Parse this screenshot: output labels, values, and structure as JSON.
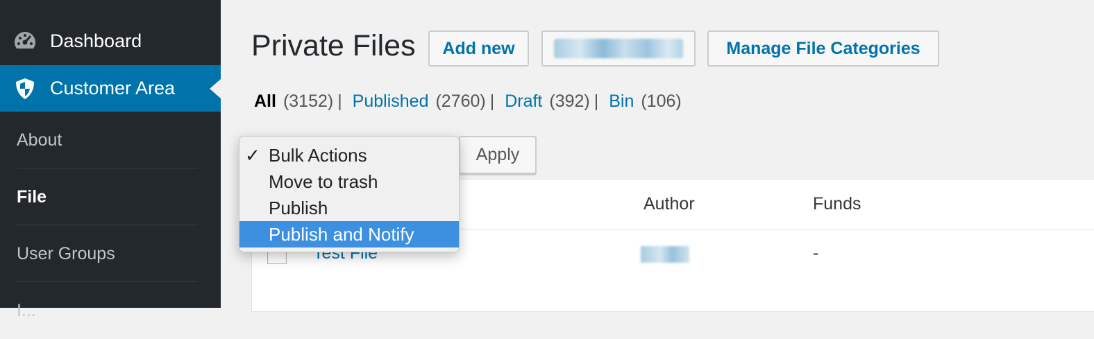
{
  "sidebar": {
    "dashboard": {
      "label": "Dashboard",
      "icon": "dashboard-gauge-icon"
    },
    "customer_area": {
      "label": "Customer Area",
      "icon": "shield-icon"
    },
    "submenu": [
      {
        "label": "About"
      },
      {
        "label": "File"
      },
      {
        "label": "User Groups"
      },
      {
        "label": "I..."
      }
    ]
  },
  "header": {
    "title": "Private Files",
    "add_new": "Add new",
    "manage_categories": "Manage File Categories"
  },
  "views": {
    "all": {
      "label": "All",
      "count": "(3152)"
    },
    "published": {
      "label": "Published",
      "count": "(2760)"
    },
    "draft": {
      "label": "Draft",
      "count": "(392)"
    },
    "bin": {
      "label": "Bin",
      "count": "(106)"
    },
    "separator": "|"
  },
  "bulk": {
    "apply": "Apply",
    "options": [
      "Bulk Actions",
      "Move to trash",
      "Publish",
      "Publish and Notify"
    ],
    "selected": "Bulk Actions",
    "highlighted": "Publish and Notify",
    "checkmark": "✓"
  },
  "table": {
    "columns": {
      "author": "Author",
      "funds": "Funds"
    },
    "rows": [
      {
        "title": "Test File",
        "funds": "-"
      }
    ]
  },
  "colors": {
    "sidebar_bg": "#23282d",
    "active_menu": "#0073aa",
    "link": "#0073aa",
    "highlight": "#3d8fe0"
  }
}
